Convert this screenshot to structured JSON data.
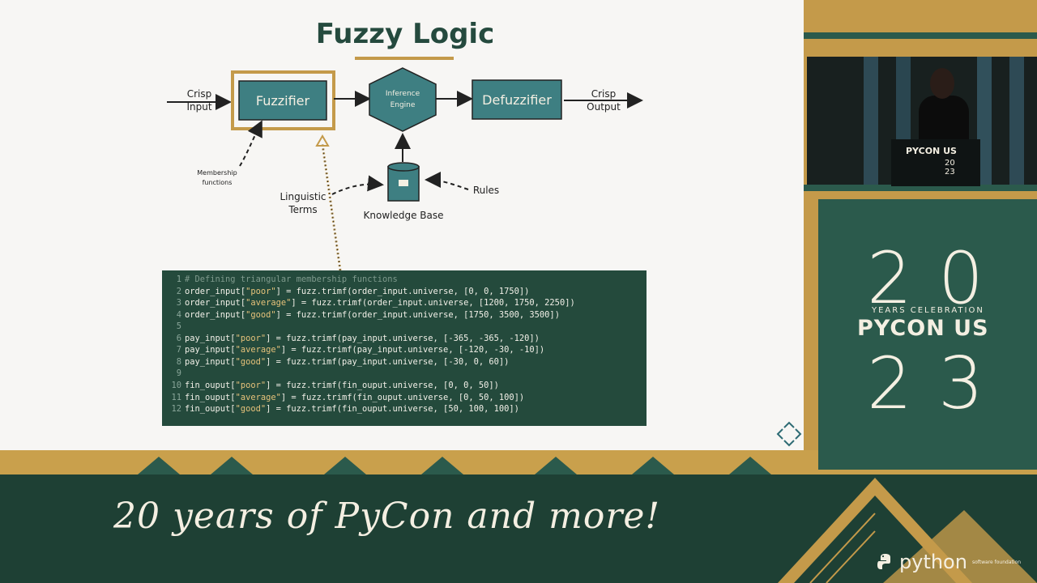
{
  "slide": {
    "title": "Fuzzy Logic",
    "diagram": {
      "crisp_input_line1": "Crisp",
      "crisp_input_line2": "Input",
      "fuzzifier": "Fuzzifier",
      "inference_line1": "Inference",
      "inference_line2": "Engine",
      "defuzzifier": "Defuzzifier",
      "crisp_output_line1": "Crisp",
      "crisp_output_line2": "Output",
      "membership_line1": "Membership",
      "membership_line2": "functions",
      "linguistic_line1": "Linguistic",
      "linguistic_line2": "Terms",
      "knowledge_base": "Knowledge Base",
      "rules": "Rules"
    },
    "code": {
      "line_numbers": [
        "1",
        "2",
        "3",
        "4",
        "5",
        "6",
        "7",
        "8",
        "9",
        "10",
        "11",
        "12"
      ],
      "lines": [
        {
          "text": "# Defining triangular membership functions",
          "kind": "comment"
        },
        {
          "pre": "order_input[",
          "str": "\"poor\"",
          "post": "] = fuzz.trimf(order_input.universe, [0, 0, 1750])"
        },
        {
          "pre": "order_input[",
          "str": "\"average\"",
          "post": "] = fuzz.trimf(order_input.universe, [1200, 1750, 2250])"
        },
        {
          "pre": "order_input[",
          "str": "\"good\"",
          "post": "] = fuzz.trimf(order_input.universe, [1750, 3500, 3500])"
        },
        {
          "pre": "",
          "str": "",
          "post": ""
        },
        {
          "pre": "pay_input[",
          "str": "\"poor\"",
          "post": "] = fuzz.trimf(pay_input.universe, [-365, -365, -120])"
        },
        {
          "pre": "pay_input[",
          "str": "\"average\"",
          "post": "] = fuzz.trimf(pay_input.universe, [-120, -30, -10])"
        },
        {
          "pre": "pay_input[",
          "str": "\"good\"",
          "post": "] = fuzz.trimf(pay_input.universe, [-30, 0, 60])"
        },
        {
          "pre": "",
          "str": "",
          "post": ""
        },
        {
          "pre": "fin_ouput[",
          "str": "\"poor\"",
          "post": "] = fuzz.trimf(fin_ouput.universe, [0, 0, 50])"
        },
        {
          "pre": "fin_ouput[",
          "str": "\"average\"",
          "post": "] = fuzz.trimf(fin_ouput.universe, [0, 50, 100])"
        },
        {
          "pre": "fin_ouput[",
          "str": "\"good\"",
          "post": "] = fuzz.trimf(fin_ouput.universe, [50, 100, 100])"
        }
      ]
    }
  },
  "video": {
    "podium_text": "PYCON US",
    "podium_num_line1": "20",
    "podium_num_line2": "23"
  },
  "branding": {
    "num_top_left": "2",
    "num_top_right": "0",
    "years_celebration": "YEARS CELEBRATION",
    "pycon_us": "PYCON US",
    "num_bottom_left": "2",
    "num_bottom_right": "3",
    "tagline": "20 years of PyCon and more!",
    "python_word": "python",
    "python_sub": "software foundation"
  },
  "colors": {
    "dark_green": "#1e4034",
    "teal": "#3e7f82",
    "gold": "#c49a4a",
    "cream": "#f4efe2"
  },
  "icons": {
    "slide_nav": "diamond-nav-icon",
    "knowledge_base": "database-icon",
    "python_logo": "python-logo-icon"
  }
}
